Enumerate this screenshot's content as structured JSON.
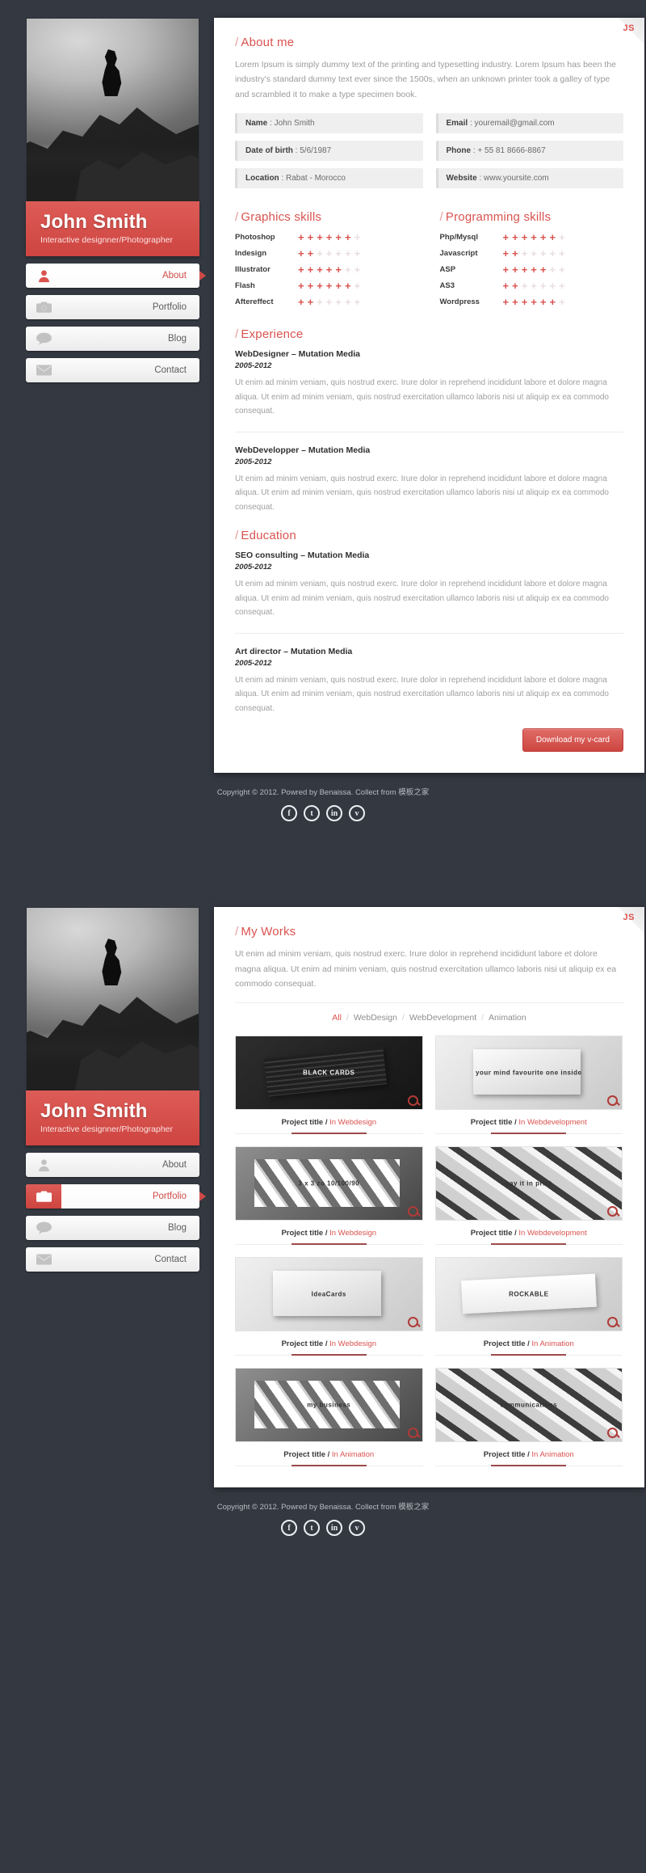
{
  "brand": {
    "badge": "JS"
  },
  "profile": {
    "name": "John Smith",
    "role": "Interactive designner/Photographer",
    "photo_alt": "mountain-climber-photo"
  },
  "nav": {
    "items": [
      {
        "label": "About",
        "icon": "user-icon",
        "active_page1": true,
        "active_page2": false
      },
      {
        "label": "Portfolio",
        "icon": "camera-icon",
        "active_page1": false,
        "active_page2": true
      },
      {
        "label": "Blog",
        "icon": "comment-icon",
        "active_page1": false,
        "active_page2": false
      },
      {
        "label": "Contact",
        "icon": "mail-icon",
        "active_page1": false,
        "active_page2": false
      }
    ]
  },
  "about": {
    "heading": "About me",
    "intro": "Lorem Ipsum is simply dummy text of the printing and typesetting industry. Lorem Ipsum has been the industry's standard dummy text ever since the 1500s, when an unknown printer took a galley of type and scrambled it to make a type specimen book.",
    "fields_left": [
      {
        "label": "Name",
        "value": "John Smith"
      },
      {
        "label": "Date of birth",
        "value": "5/6/1987"
      },
      {
        "label": "Location",
        "value": "Rabat - Morocco"
      }
    ],
    "fields_right": [
      {
        "label": "Email",
        "value": "youremail@gmail.com"
      },
      {
        "label": "Phone",
        "value": "+ 55 81 8666-8867"
      },
      {
        "label": "Website",
        "value": "www.yoursite.com"
      }
    ]
  },
  "graphics_skills": {
    "heading": "Graphics skills",
    "total": 7,
    "items": [
      {
        "name": "Photoshop",
        "rating": 6
      },
      {
        "name": "Indesign",
        "rating": 2
      },
      {
        "name": "Illustrator",
        "rating": 5
      },
      {
        "name": "Flash",
        "rating": 6
      },
      {
        "name": "Aftereffect",
        "rating": 2
      }
    ]
  },
  "programming_skills": {
    "heading": "Programming skills",
    "total": 7,
    "items": [
      {
        "name": "Php/Mysql",
        "rating": 6
      },
      {
        "name": "Javascript",
        "rating": 2
      },
      {
        "name": "ASP",
        "rating": 5
      },
      {
        "name": "AS3",
        "rating": 2
      },
      {
        "name": "Wordpress",
        "rating": 6
      }
    ]
  },
  "experience": {
    "heading": "Experience",
    "jobs": [
      {
        "title": "WebDesigner – Mutation Media",
        "years": "2005-2012",
        "desc": "Ut enim ad minim veniam, quis nostrud exerc. Irure dolor in reprehend incididunt labore et dolore magna aliqua. Ut enim ad minim veniam, quis nostrud exercitation ullamco laboris nisi ut aliquip ex ea commodo consequat."
      },
      {
        "title": "WebDevelopper – Mutation Media",
        "years": "2005-2012",
        "desc": "Ut enim ad minim veniam, quis nostrud exerc. Irure dolor in reprehend incididunt labore et dolore magna aliqua. Ut enim ad minim veniam, quis nostrud exercitation ullamco laboris nisi ut aliquip ex ea commodo consequat."
      }
    ]
  },
  "education": {
    "heading": "Education",
    "jobs": [
      {
        "title": "SEO consulting – Mutation Media",
        "years": "2005-2012",
        "desc": "Ut enim ad minim veniam, quis nostrud exerc. Irure dolor in reprehend incididunt labore et dolore magna aliqua. Ut enim ad minim veniam, quis nostrud exercitation ullamco laboris nisi ut aliquip ex ea commodo consequat."
      },
      {
        "title": "Art director – Mutation Media",
        "years": "2005-2012",
        "desc": "Ut enim ad minim veniam, quis nostrud exerc. Irure dolor in reprehend incididunt labore et dolore magna aliqua. Ut enim ad minim veniam, quis nostrud exercitation ullamco laboris nisi ut aliquip ex ea commodo consequat."
      }
    ]
  },
  "vcard_button": "Download my v-card",
  "works": {
    "heading": "My Works",
    "intro": "Ut enim ad minim veniam, quis nostrud exerc. Irure dolor in reprehend incididunt labore et dolore magna aliqua. Ut enim ad minim veniam, quis nostrud exercitation ullamco laboris nisi ut aliquip ex ea commodo consequat.",
    "filters": [
      {
        "label": "All",
        "active": true
      },
      {
        "label": "WebDesign",
        "active": false
      },
      {
        "label": "WebDevelopment",
        "active": false
      },
      {
        "label": "Animation",
        "active": false
      }
    ],
    "separator": "/",
    "projects": [
      {
        "title": "Project title",
        "sep": "/",
        "category": "In Webdesign",
        "art": "stack-dark",
        "art_text": "BLACK CARDS"
      },
      {
        "title": "Project title",
        "sep": "/",
        "category": "In Webdevelopment",
        "art": "box-white",
        "art_text": "your mind favourite one inside"
      },
      {
        "title": "Project title",
        "sep": "/",
        "category": "In Webdesign",
        "art": "cards-slant",
        "art_text": "3 x 3 zo 10/100/90"
      },
      {
        "title": "Project title",
        "sep": "/",
        "category": "In Webdevelopment",
        "art": "tags",
        "art_text": "say it in print"
      },
      {
        "title": "Project title",
        "sep": "/",
        "category": "In Webdesign",
        "art": "box-white",
        "art_text": "IdeaCards"
      },
      {
        "title": "Project title",
        "sep": "/",
        "category": "In Animation",
        "art": "white-card",
        "art_text": "ROCKABLE"
      },
      {
        "title": "Project title",
        "sep": "/",
        "category": "In Animation",
        "art": "cards-slant",
        "art_text": "my business"
      },
      {
        "title": "Project title",
        "sep": "/",
        "category": "In Animation",
        "art": "tags",
        "art_text": "communications"
      }
    ]
  },
  "footer": {
    "copyright": "Copyright © 2012. Powred by Benaissa. Collect from 模板之家",
    "socials": [
      {
        "name": "facebook-icon",
        "glyph": "f"
      },
      {
        "name": "twitter-icon",
        "glyph": "t"
      },
      {
        "name": "linkedin-icon",
        "glyph": "in"
      },
      {
        "name": "vimeo-icon",
        "glyph": "v"
      }
    ]
  },
  "colors": {
    "accent": "#d9534f",
    "page_bg": "#343841",
    "panel_bg": "#ffffff"
  }
}
